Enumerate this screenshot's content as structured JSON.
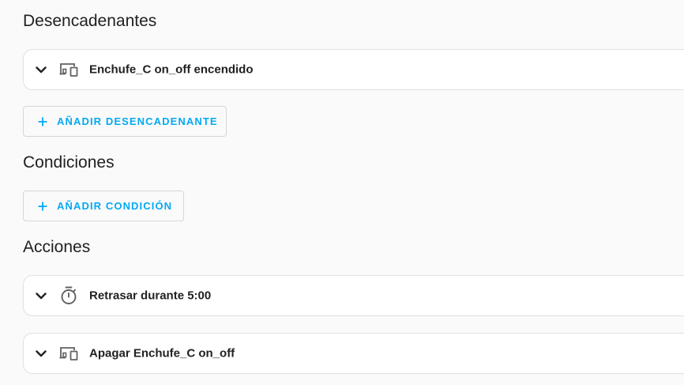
{
  "triggers": {
    "title": "Desencadenantes",
    "items": [
      {
        "label": "Enchufe_C on_off encendido",
        "icon": "device-icon"
      }
    ],
    "add_label": "AÑADIR DESENCADENANTE"
  },
  "conditions": {
    "title": "Condiciones",
    "add_label": "AÑADIR CONDICIÓN"
  },
  "actions": {
    "title": "Acciones",
    "items": [
      {
        "label": "Retrasar durante 5:00",
        "icon": "timer-icon"
      },
      {
        "label": "Apagar Enchufe_C on_off",
        "icon": "device-icon"
      }
    ]
  },
  "colors": {
    "accent": "#03a9f4",
    "background": "#fafafa",
    "card": "#ffffff",
    "border": "#e0e0e0",
    "text": "#212121",
    "icon": "#616161"
  }
}
